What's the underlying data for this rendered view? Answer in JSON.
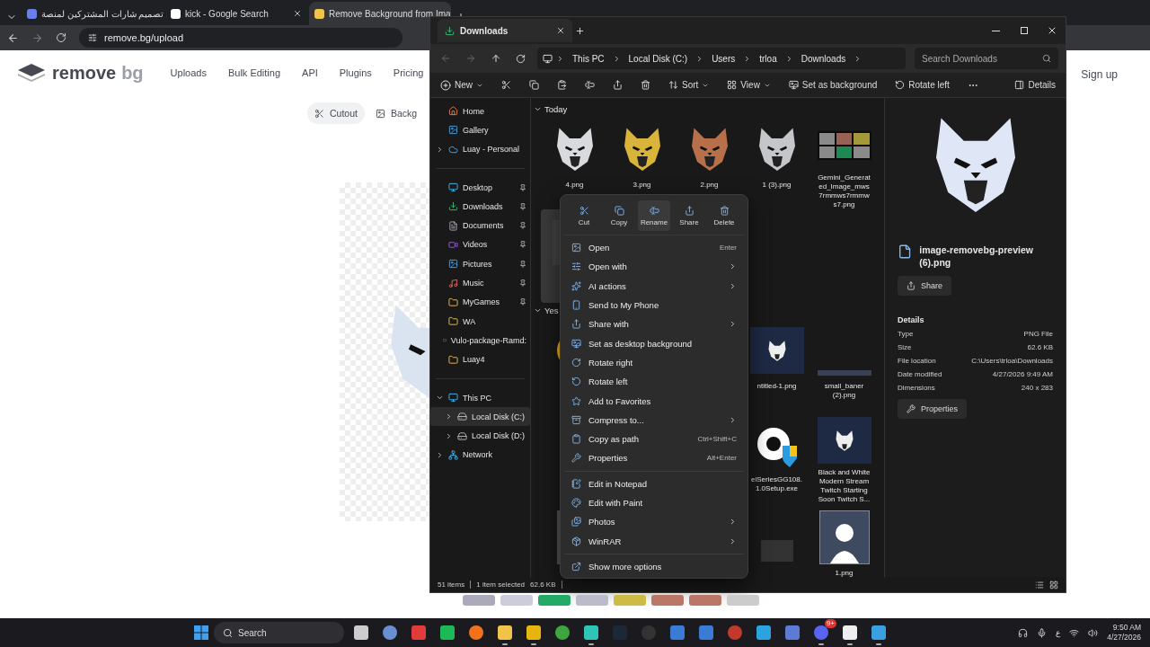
{
  "browser": {
    "tabs": [
      {
        "title": "تصميم شارات المشتركين لمنصة",
        "selected": false
      },
      {
        "title": "kick - Google Search",
        "selected": false
      },
      {
        "title": "Remove Background from Ima",
        "selected": true
      }
    ],
    "url": "remove.bg/upload"
  },
  "site": {
    "logo": "remove",
    "logo_suffix": "bg",
    "nav": [
      "Uploads",
      "Bulk Editing",
      "API",
      "Plugins",
      "Pricing"
    ],
    "sign_up": "Sign up",
    "modes": [
      {
        "label": "Cutout",
        "selected": true
      },
      {
        "label": "Backg",
        "selected": false
      }
    ]
  },
  "explorer": {
    "tab": "Downloads",
    "breadcrumb": [
      "This PC",
      "Local Disk (C:)",
      "Users",
      "trloa",
      "Downloads"
    ],
    "search": {
      "placeholder": "Search Downloads"
    },
    "toolbar": {
      "new": "New",
      "sort": "Sort",
      "view": "View",
      "set_background": "Set as background",
      "rotate_left": "Rotate left",
      "details": "Details"
    },
    "sidebar": [
      [
        {
          "label": "Home",
          "kind": "home"
        },
        {
          "label": "Gallery",
          "kind": "gallery"
        },
        {
          "label": "Luay - Personal",
          "kind": "cloud",
          "expanded": false
        }
      ],
      [
        {
          "label": "Desktop",
          "kind": "desktop",
          "pinned": true
        },
        {
          "label": "Downloads",
          "kind": "download",
          "pinned": true
        },
        {
          "label": "Documents",
          "kind": "doc",
          "pinned": true
        },
        {
          "label": "Videos",
          "kind": "video",
          "pinned": true
        },
        {
          "label": "Pictures",
          "kind": "gallery",
          "pinned": true
        },
        {
          "label": "Music",
          "kind": "music",
          "pinned": true
        },
        {
          "label": "MyGames",
          "kind": "folder",
          "pinned": true
        },
        {
          "label": "WA",
          "kind": "folder",
          "pinned": false
        },
        {
          "label": "Vulo-package-Ramd:",
          "kind": "folder",
          "pinned": false
        },
        {
          "label": "Luay4",
          "kind": "folder",
          "pinned": false
        }
      ],
      [
        {
          "label": "This PC",
          "kind": "pc",
          "expanded": true,
          "selected": false,
          "children": [
            {
              "label": "Local Disk (C:)",
              "kind": "disk",
              "expanded": false,
              "selected": true
            },
            {
              "label": "Local Disk (D:)",
              "kind": "disk",
              "expanded": false,
              "selected": false
            }
          ]
        },
        {
          "label": "Network",
          "kind": "network",
          "expanded": false,
          "selected": false
        }
      ]
    ],
    "groups": [
      {
        "title": "Today",
        "rows": [
          [
            {
              "label": "4.png",
              "kind": "wolf",
              "color": "#d8dadd"
            },
            {
              "label": "3.png",
              "kind": "wolf",
              "color": "#d8b43a"
            },
            {
              "label": "2.png",
              "kind": "wolf",
              "color": "#b8704a"
            },
            {
              "label": "1 (3).png",
              "kind": "wolf",
              "color": "#c4c6c9"
            },
            {
              "label": "Gemini_Generated_Image_mws7rmmws7rmmws7.png",
              "kind": "sheet"
            }
          ],
          [
            {
              "kind": "image",
              "selected": true
            }
          ]
        ]
      },
      {
        "title": "Yes",
        "rows": [
          [
            {
              "kind": "gold"
            },
            {
              "kind": "blank"
            },
            {
              "kind": "blank"
            },
            {
              "label": "ntitled-1.png",
              "kind": "banner"
            },
            {
              "label": "small_baner (2).png",
              "kind": "strip"
            }
          ],
          [
            {
              "kind": "blank"
            },
            {
              "kind": "blank"
            },
            {
              "kind": "blank"
            },
            {
              "label": "elSeriesGG108.1.0Setup.exe",
              "kind": "setup"
            },
            {
              "label": "Black and White Modern Stream Twitch Starting Soon Twitch S...",
              "kind": "banner"
            }
          ],
          [
            {
              "kind": "checker"
            },
            {
              "kind": "blank"
            },
            {
              "kind": "blank"
            },
            {
              "kind": "photo"
            },
            {
              "label": "1.png",
              "kind": "person"
            }
          ]
        ]
      }
    ],
    "preview": {
      "file_name": "image-removebg-preview (6).png",
      "share": "Share",
      "details_title": "Details",
      "details": [
        {
          "label": "Type",
          "value": "PNG File"
        },
        {
          "label": "Size",
          "value": "62.6 KB"
        },
        {
          "label": "File location",
          "value": "C:\\Users\\trloa\\Downloads"
        },
        {
          "label": "Date modified",
          "value": "4/27/2026 9:49 AM"
        },
        {
          "label": "Dimensions",
          "value": "240 x 283"
        }
      ],
      "properties": "Properties"
    },
    "status": {
      "items": "51 items",
      "selection": "1 item selected",
      "size": "62.6 KB"
    }
  },
  "context_menu": {
    "actions": [
      {
        "label": "Cut",
        "kind": "cut",
        "hovered": false
      },
      {
        "label": "Copy",
        "kind": "copy",
        "hovered": false
      },
      {
        "label": "Rename",
        "kind": "rename",
        "hovered": true
      },
      {
        "label": "Share",
        "kind": "share",
        "hovered": false
      },
      {
        "label": "Delete",
        "kind": "delete",
        "hovered": false
      }
    ],
    "items": [
      {
        "kind": "open",
        "label": "Open",
        "shortcut": "Enter",
        "submenu": false
      },
      {
        "kind": "openwith",
        "label": "Open with",
        "submenu": true
      },
      {
        "kind": "ai",
        "label": "AI actions",
        "submenu": true
      },
      {
        "kind": "phone",
        "label": "Send to My Phone",
        "submenu": false
      },
      {
        "kind": "share",
        "label": "Share with",
        "submenu": true
      },
      {
        "kind": "wallpaper",
        "label": "Set as desktop background",
        "submenu": false
      },
      {
        "kind": "rotr",
        "label": "Rotate right",
        "submenu": false
      },
      {
        "kind": "rotl",
        "label": "Rotate left",
        "submenu": false
      },
      {
        "kind": "star",
        "label": "Add to Favorites",
        "submenu": false
      },
      {
        "kind": "zip",
        "label": "Compress to...",
        "submenu": true
      },
      {
        "kind": "path",
        "label": "Copy as path",
        "shortcut": "Ctrl+Shift+C",
        "submenu": false
      },
      {
        "kind": "wrench",
        "label": "Properties",
        "shortcut": "Alt+Enter",
        "submenu": false
      },
      {
        "kind": "separator"
      },
      {
        "kind": "notepad",
        "label": "Edit in Notepad",
        "submenu": false
      },
      {
        "kind": "paint",
        "label": "Edit with Paint",
        "submenu": false
      },
      {
        "kind": "photos",
        "label": "Photos",
        "submenu": true
      },
      {
        "kind": "winrar",
        "label": "WinRAR",
        "submenu": true
      },
      {
        "kind": "separator"
      },
      {
        "kind": "more",
        "label": "Show more options",
        "submenu": false
      }
    ]
  },
  "taskbar": {
    "search": "Search",
    "apps": [
      {
        "kind": "taskview",
        "open": false
      },
      {
        "kind": "calc",
        "open": false
      },
      {
        "kind": "red",
        "open": false
      },
      {
        "kind": "green",
        "open": false
      },
      {
        "kind": "orange",
        "open": false
      },
      {
        "kind": "explorer",
        "open": true
      },
      {
        "kind": "chrome",
        "open": true
      },
      {
        "kind": "xbox",
        "open": false
      },
      {
        "kind": "teal",
        "open": true
      },
      {
        "kind": "steam",
        "open": false
      },
      {
        "kind": "epic",
        "open": false
      },
      {
        "kind": "blue",
        "open": false
      },
      {
        "kind": "blue",
        "open": false
      },
      {
        "kind": "voice",
        "open": false
      },
      {
        "kind": "telegram",
        "open": false
      },
      {
        "kind": "remote",
        "open": false
      },
      {
        "kind": "discord",
        "open": true,
        "badge": "9+"
      },
      {
        "kind": "steelseries",
        "open": true
      },
      {
        "kind": "paint",
        "open": true
      }
    ],
    "lang": "ع",
    "time": "9:50 AM",
    "date": "4/27/2026"
  }
}
